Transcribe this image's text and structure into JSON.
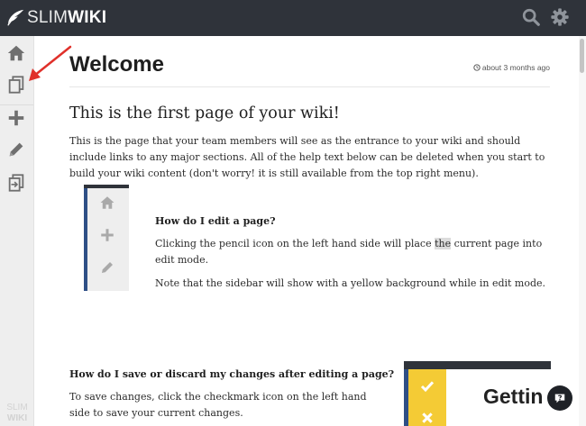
{
  "brand": {
    "light": "SLIM",
    "bold": "WIKI"
  },
  "sidebar": {
    "logo_line1": "SLIM",
    "logo_line2": "WIKI"
  },
  "page": {
    "title": "Welcome",
    "updated": "about 3 months ago"
  },
  "content": {
    "heading": "This is the first page of your wiki!",
    "intro": "This is the page that your team members will see as the entrance to your wiki and should include links to any major sections.  All of the help text below can be deleted when you start to build your wiki content (don't worry! it is still available from the top right menu).",
    "edit_question": "How do I edit a page?",
    "edit_answer_pre": "Clicking the pencil icon on the left hand side will place ",
    "edit_answer_hl": "the",
    "edit_answer_post": " current page into edit mode.",
    "edit_note": "Note that the sidebar will show with a yellow background while in edit mode.",
    "save_question": "How do I save or discard my changes after editing a page?",
    "save_answer": "To save changes,  click the checkmark icon on the left hand side to save your current changes.",
    "illustration_text": "Gettin"
  },
  "colors": {
    "topbar": "#2f333a",
    "sidebar": "#eeeeee",
    "accent_blue": "#2e4f86",
    "edit_yellow": "#f4cb35",
    "annotation_red": "#e0302a"
  },
  "icons": {
    "top": [
      "search-icon",
      "gear-icon"
    ],
    "sidebar": [
      "home-icon",
      "pages-icon",
      "plus-icon",
      "pencil-icon",
      "export-icon"
    ],
    "help": "question-icon"
  }
}
